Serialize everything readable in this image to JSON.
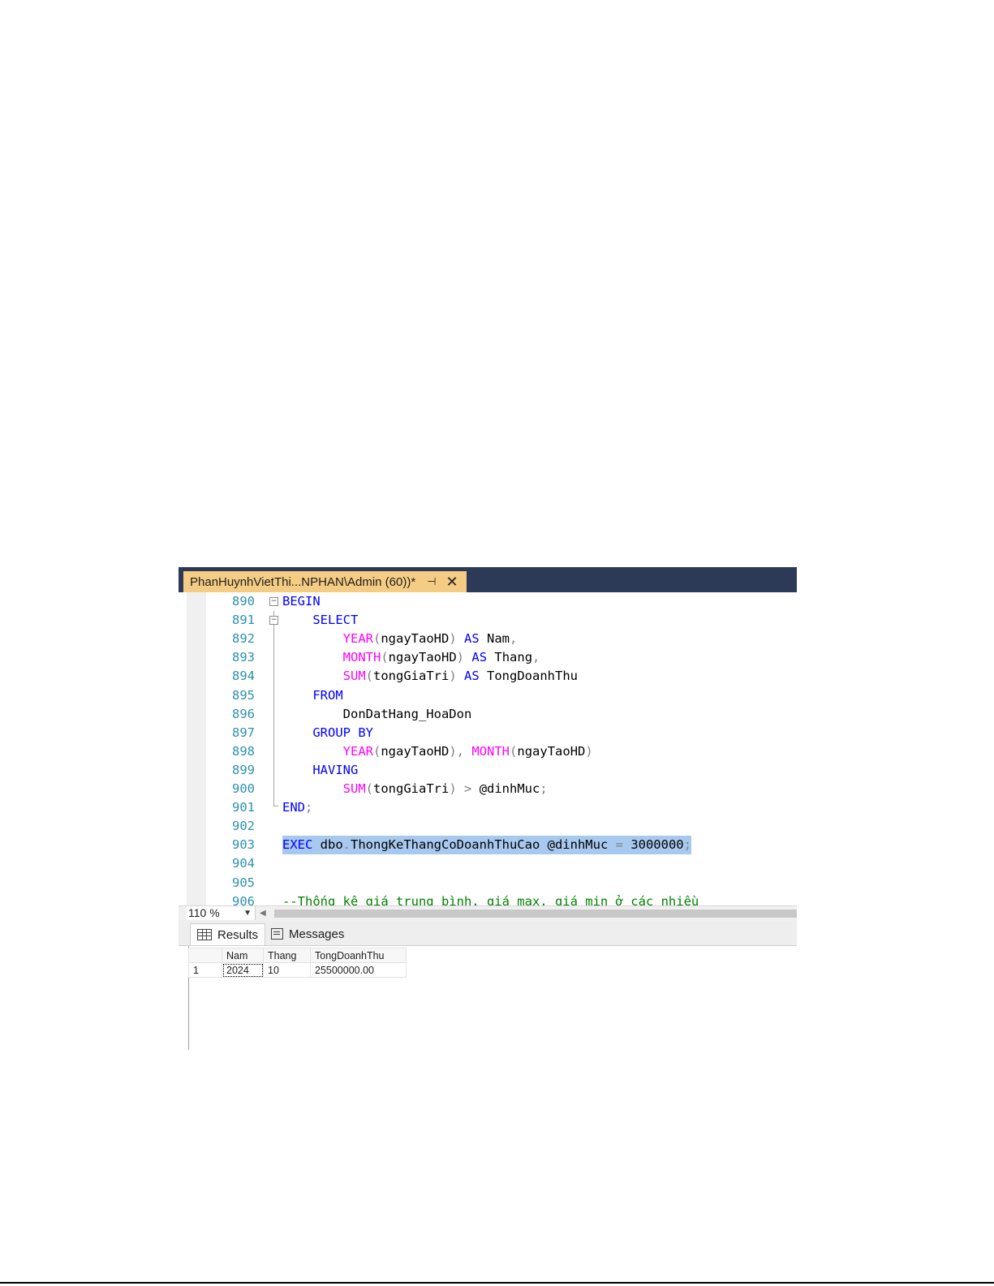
{
  "window": {
    "tab_title": "PhanHuynhVietThi...NPHAN\\Admin (60))*",
    "pin_glyph": "⊣",
    "close_glyph": "✕"
  },
  "editor": {
    "lines": [
      {
        "num": "890",
        "tokens": [
          {
            "t": "BEGIN",
            "c": "kw"
          }
        ]
      },
      {
        "num": "891",
        "tokens": [
          {
            "t": "    "
          },
          {
            "t": "SELECT",
            "c": "kw"
          }
        ]
      },
      {
        "num": "892",
        "tokens": [
          {
            "t": "        "
          },
          {
            "t": "YEAR",
            "c": "fn"
          },
          {
            "t": "(",
            "c": "op"
          },
          {
            "t": "ngayTaoHD",
            "c": "id"
          },
          {
            "t": ")",
            "c": "op"
          },
          {
            "t": " "
          },
          {
            "t": "AS",
            "c": "kw"
          },
          {
            "t": " Nam",
            "c": "id"
          },
          {
            "t": ",",
            "c": "op"
          }
        ]
      },
      {
        "num": "893",
        "tokens": [
          {
            "t": "        "
          },
          {
            "t": "MONTH",
            "c": "fn"
          },
          {
            "t": "(",
            "c": "op"
          },
          {
            "t": "ngayTaoHD",
            "c": "id"
          },
          {
            "t": ")",
            "c": "op"
          },
          {
            "t": " "
          },
          {
            "t": "AS",
            "c": "kw"
          },
          {
            "t": " Thang",
            "c": "id"
          },
          {
            "t": ",",
            "c": "op"
          }
        ]
      },
      {
        "num": "894",
        "tokens": [
          {
            "t": "        "
          },
          {
            "t": "SUM",
            "c": "fn"
          },
          {
            "t": "(",
            "c": "op"
          },
          {
            "t": "tongGiaTri",
            "c": "id"
          },
          {
            "t": ")",
            "c": "op"
          },
          {
            "t": " "
          },
          {
            "t": "AS",
            "c": "kw"
          },
          {
            "t": " TongDoanhThu",
            "c": "id"
          }
        ]
      },
      {
        "num": "895",
        "tokens": [
          {
            "t": "    "
          },
          {
            "t": "FROM",
            "c": "kw"
          }
        ]
      },
      {
        "num": "896",
        "tokens": [
          {
            "t": "        "
          },
          {
            "t": "DonDatHang_HoaDon",
            "c": "id"
          }
        ]
      },
      {
        "num": "897",
        "tokens": [
          {
            "t": "    "
          },
          {
            "t": "GROUP BY",
            "c": "kw"
          }
        ]
      },
      {
        "num": "898",
        "tokens": [
          {
            "t": "        "
          },
          {
            "t": "YEAR",
            "c": "fn"
          },
          {
            "t": "(",
            "c": "op"
          },
          {
            "t": "ngayTaoHD",
            "c": "id"
          },
          {
            "t": ")",
            "c": "op"
          },
          {
            "t": ",",
            "c": "op"
          },
          {
            "t": " "
          },
          {
            "t": "MONTH",
            "c": "fn"
          },
          {
            "t": "(",
            "c": "op"
          },
          {
            "t": "ngayTaoHD",
            "c": "id"
          },
          {
            "t": ")",
            "c": "op"
          }
        ]
      },
      {
        "num": "899",
        "tokens": [
          {
            "t": "    "
          },
          {
            "t": "HAVING",
            "c": "kw"
          }
        ]
      },
      {
        "num": "900",
        "tokens": [
          {
            "t": "        "
          },
          {
            "t": "SUM",
            "c": "fn"
          },
          {
            "t": "(",
            "c": "op"
          },
          {
            "t": "tongGiaTri",
            "c": "id"
          },
          {
            "t": ")",
            "c": "op"
          },
          {
            "t": " "
          },
          {
            "t": ">",
            "c": "op"
          },
          {
            "t": " @dinhMuc",
            "c": "id"
          },
          {
            "t": ";",
            "c": "op"
          }
        ]
      },
      {
        "num": "901",
        "tokens": [
          {
            "t": "END",
            "c": "kw"
          },
          {
            "t": ";",
            "c": "op"
          }
        ]
      },
      {
        "num": "902",
        "tokens": []
      },
      {
        "num": "903",
        "highlight": true,
        "tokens": [
          {
            "t": "EXEC",
            "c": "kw"
          },
          {
            "t": " dbo",
            "c": "id"
          },
          {
            "t": ".",
            "c": "op"
          },
          {
            "t": "ThongKeThangCoDoanhThuCao",
            "c": "id"
          },
          {
            "t": " @dinhMuc",
            "c": "id"
          },
          {
            "t": " "
          },
          {
            "t": "=",
            "c": "op"
          },
          {
            "t": " 3000000",
            "c": "id"
          },
          {
            "t": ";",
            "c": "op"
          }
        ]
      },
      {
        "num": "904",
        "tokens": []
      },
      {
        "num": "905",
        "tokens": []
      },
      {
        "num": "906",
        "tokens": [
          {
            "t": "--Thống kê giá trung bình, giá max, giá min ở các nhiều",
            "c": "cm"
          }
        ]
      }
    ]
  },
  "statusbar": {
    "zoom": "110 %",
    "zoom_arrow": "▼",
    "scroll_left": "◀"
  },
  "results": {
    "tab_results": "Results",
    "tab_messages": "Messages",
    "columns": [
      "",
      "Nam",
      "Thang",
      "TongDoanhThu"
    ],
    "rows": [
      [
        "1",
        "2024",
        "10",
        "25500000.00"
      ]
    ]
  }
}
